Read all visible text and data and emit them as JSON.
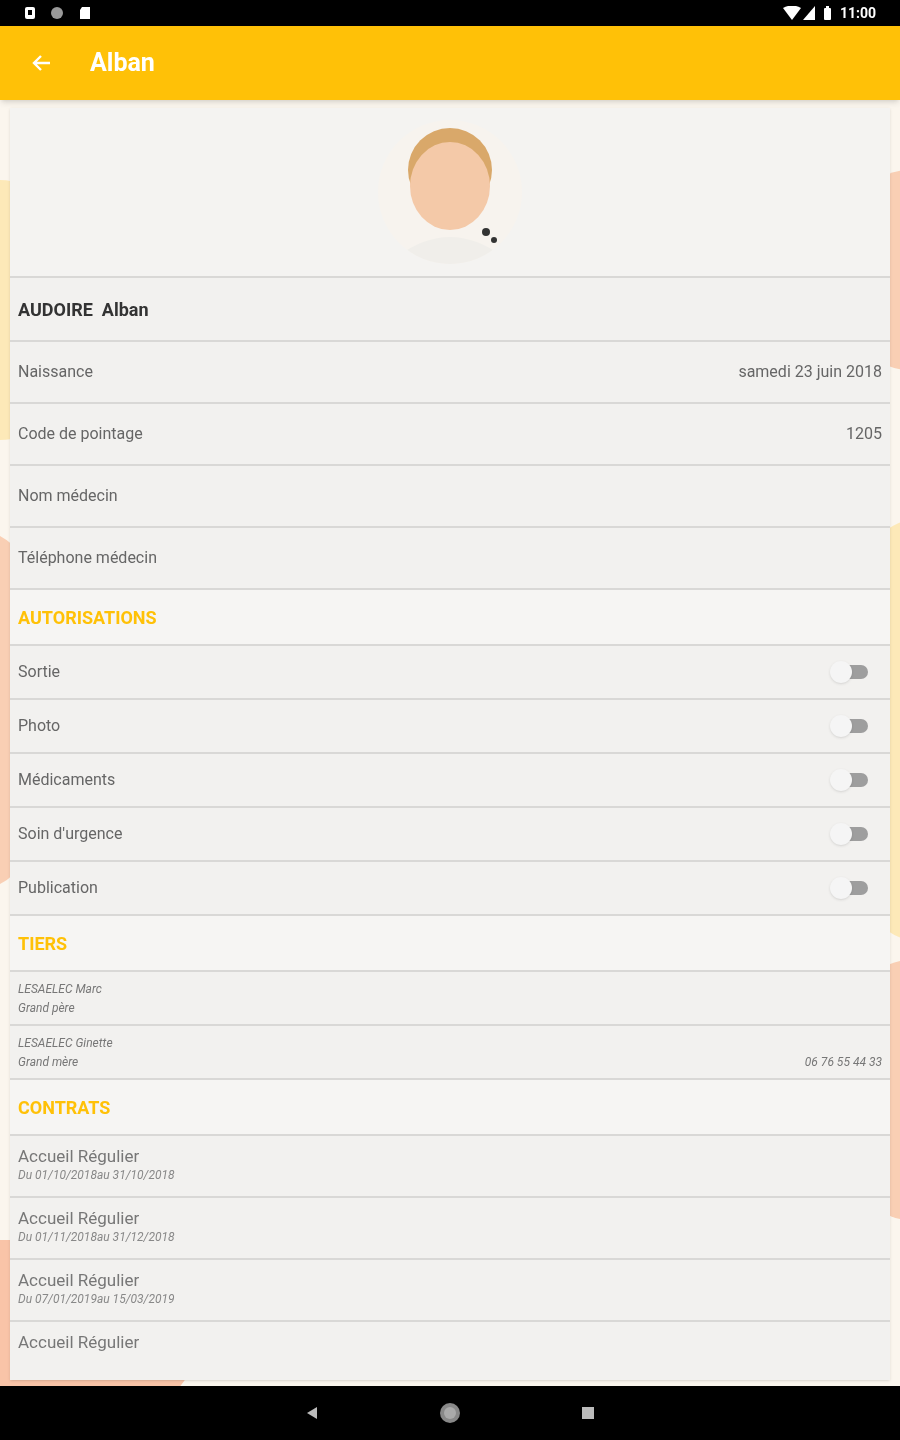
{
  "status_bar": {
    "time": "11:00"
  },
  "app_bar": {
    "title": "Alban"
  },
  "profile": {
    "full_name": "AUDOIRE  Alban"
  },
  "details": [
    {
      "label": "Naissance",
      "value": "samedi 23 juin 2018"
    },
    {
      "label": "Code de pointage",
      "value": "1205"
    },
    {
      "label": "Nom médecin"
    },
    {
      "label": "Téléphone médecin"
    }
  ],
  "autorisations": {
    "title": "AUTORISATIONS",
    "items": [
      {
        "label": "Sortie",
        "on": false
      },
      {
        "label": "Photo",
        "on": false
      },
      {
        "label": "Médicaments",
        "on": false
      },
      {
        "label": "Soin d'urgence",
        "on": false
      },
      {
        "label": "Publication",
        "on": false
      }
    ]
  },
  "tiers": {
    "title": "TIERS",
    "items": [
      {
        "name": "LESAELEC Marc",
        "relation": "Grand père"
      },
      {
        "name": "LESAELEC Ginette",
        "relation": "Grand mère",
        "phone": "06 76 55 44 33"
      }
    ]
  },
  "contrats": {
    "title": "CONTRATS",
    "items": [
      {
        "title": "Accueil Régulier",
        "period": "Du 01/10/2018au 31/10/2018"
      },
      {
        "title": "Accueil Régulier",
        "period": "Du 01/11/2018au 31/12/2018"
      },
      {
        "title": "Accueil Régulier",
        "period": "Du 07/01/2019au 15/03/2019"
      },
      {
        "title": "Accueil Régulier"
      }
    ]
  }
}
